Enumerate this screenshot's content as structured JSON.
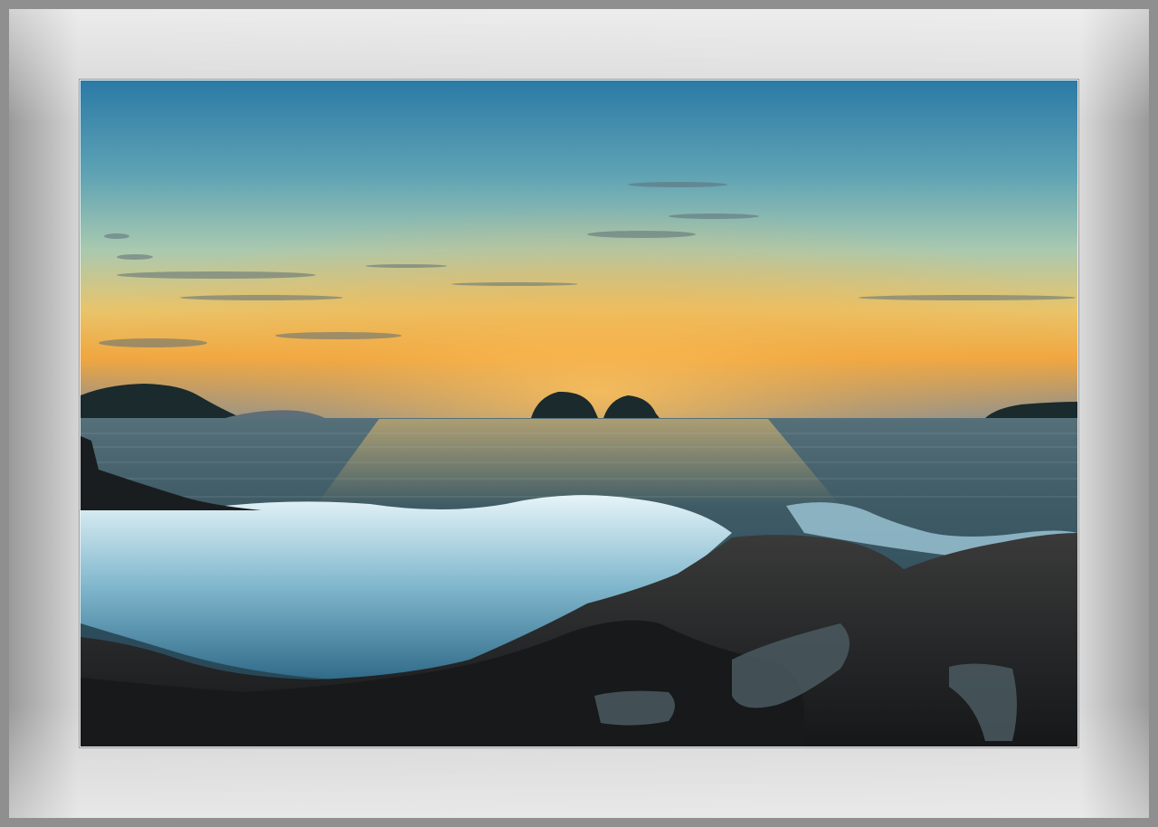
{
  "frame": {
    "mat_color": "#d6d6d6",
    "outer_border_color": "#8f8f8f"
  },
  "photo": {
    "subject": "sunset seascape",
    "elements": [
      "gradient-sky",
      "wispy-clouds",
      "horizon-islands",
      "ocean",
      "crashing-wave",
      "dark-rocky-shore",
      "tide-pools"
    ],
    "colors": {
      "sky_top": "#2a7fa8",
      "sky_mid": "#8fc0b8",
      "sky_glow": "#f2b040",
      "horizon": "#e8a65a",
      "sea": "#2a4a5a",
      "foam": "#cfe8f2",
      "rock": "#1f2224"
    }
  }
}
